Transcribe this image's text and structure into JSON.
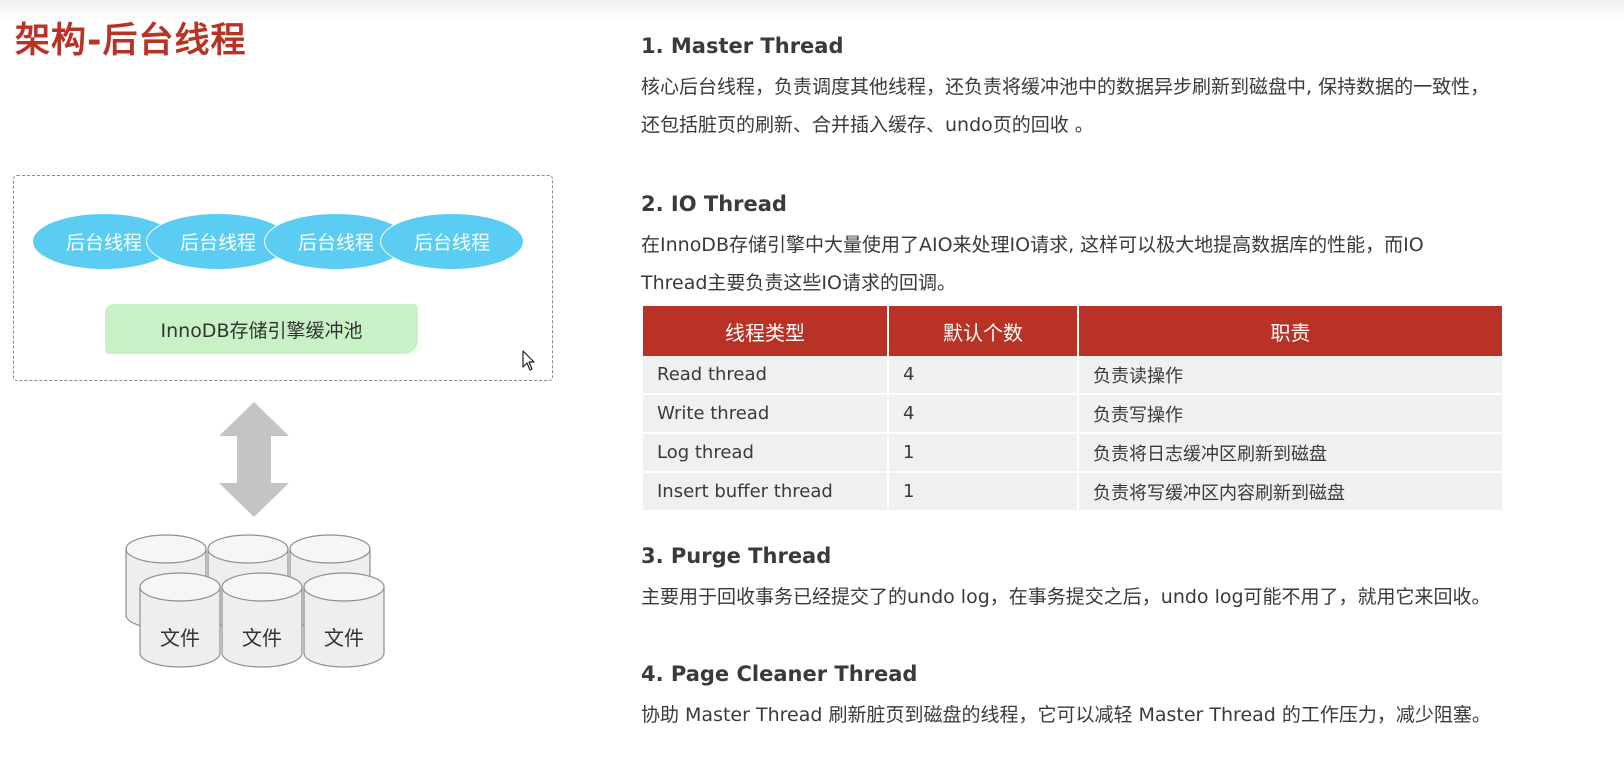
{
  "page": {
    "title": "架构-后台线程"
  },
  "diagram": {
    "threads": [
      "后台线程",
      "后台线程",
      "后台线程",
      "后台线程"
    ],
    "buffer_pool_label": "InnoDB存储引擎缓冲池",
    "files": [
      "文件",
      "文件",
      "文件"
    ]
  },
  "sections": {
    "master": {
      "title": "1. Master Thread",
      "lines": [
        "核心后台线程，负责调度其他线程，还负责将缓冲池中的数据异步刷新到磁盘中, 保持数据的一致性，",
        "还包括脏页的刷新、合并插入缓存、undo页的回收 。"
      ]
    },
    "io": {
      "title": "2. IO Thread",
      "lines": [
        "在InnoDB存储引擎中大量使用了AIO来处理IO请求, 这样可以极大地提高数据库的性能，而IO",
        "Thread主要负责这些IO请求的回调。"
      ]
    },
    "purge": {
      "title": "3. Purge Thread",
      "lines": [
        "主要用于回收事务已经提交了的undo log，在事务提交之后，undo log可能不用了，就用它来回收。"
      ]
    },
    "page_cleaner": {
      "title": "4. Page Cleaner Thread",
      "lines": [
        "协助 Master Thread 刷新脏页到磁盘的线程，它可以减轻 Master Thread 的工作压力，减少阻塞。"
      ]
    }
  },
  "io_table": {
    "headers": [
      "线程类型",
      "默认个数",
      "职责"
    ],
    "rows": [
      [
        "Read thread",
        "4",
        "负责读操作"
      ],
      [
        "Write thread",
        "4",
        "负责写操作"
      ],
      [
        "Log thread",
        "1",
        "负责将日志缓冲区刷新到磁盘"
      ],
      [
        "Insert buffer thread",
        "1",
        "负责将写缓冲区内容刷新到磁盘"
      ]
    ]
  },
  "colors": {
    "accent": "#b83325",
    "thread_ellipse": "#5bcdf2",
    "buffer_pool": "#c8f2c5",
    "table_row": "#f0f0f0",
    "arrow": "#c4c4c4"
  },
  "icons": {
    "cursor": "mouse-pointer-icon",
    "arrow": "double-arrow-icon",
    "file": "database-cylinder-icon"
  }
}
